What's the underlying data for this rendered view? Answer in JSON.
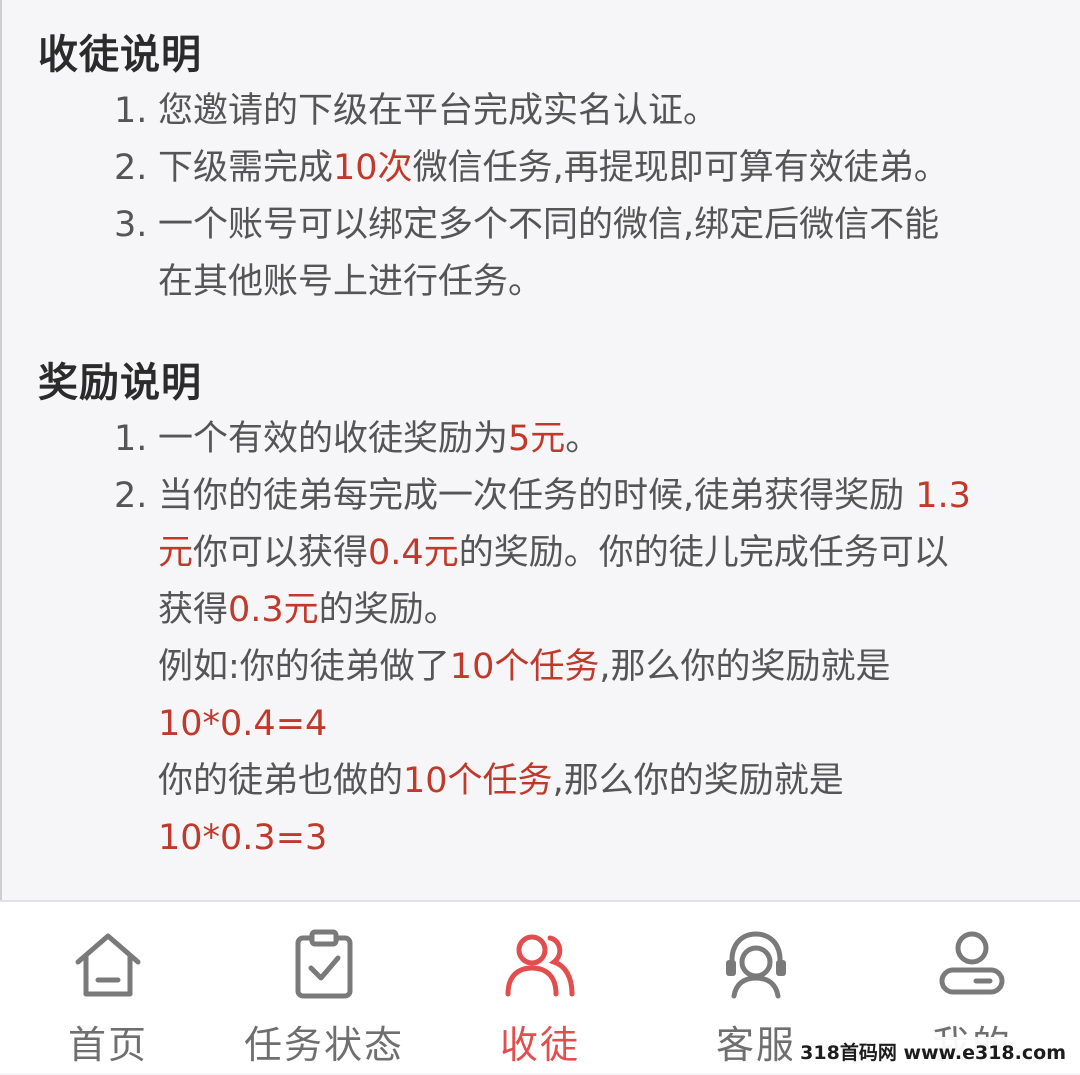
{
  "recruit_section": {
    "title": "收徒说明",
    "items": [
      {
        "num": "1.",
        "parts": [
          "您邀请的下级在平台完成实名认证。"
        ]
      },
      {
        "num": "2.",
        "parts": [
          "下级需完成",
          "10次",
          "微信任务,再提现即可算有效徒弟。"
        ]
      },
      {
        "num": "3.",
        "lines": [
          "一个账号可以绑定多个不同的微信,绑定后微信不能",
          "在其他账号上进行任务。"
        ]
      }
    ]
  },
  "reward_section": {
    "title": "奖励说明",
    "item1": {
      "num": "1.",
      "text": "一个有效的收徒奖励为",
      "amount": "5元",
      "end": "。"
    },
    "item2": {
      "num": "2.",
      "l1_text": "当你的徒弟每完成一次任务的时候,徒弟获得奖励 ",
      "l1_hl": "1.3",
      "l2_hl1": "元",
      "l2_text1": "你可以获得",
      "l2_hl2": "0.4元",
      "l2_text2": "的奖励。你的徒儿完成任务可以",
      "l3_text1": "获得",
      "l3_hl": "0.3元",
      "l3_text2": "的奖励。",
      "ex1_text1": "例如:你的徒弟做了",
      "ex1_hl": "10个任务",
      "ex1_text2": ",那么你的奖励就是",
      "ex1_formula": "10*0.4=4",
      "ex2_text1": "你的徒弟也做的",
      "ex2_hl": "10个任务",
      "ex2_text2": ",那么你的奖励就是",
      "ex2_formula": "10*0.3=3"
    }
  },
  "tabbar": {
    "tabs": [
      {
        "label": "首页",
        "icon": "home-icon",
        "active": false
      },
      {
        "label": "任务状态",
        "icon": "clipboard-check-icon",
        "active": false
      },
      {
        "label": "收徒",
        "icon": "users-icon",
        "active": true
      },
      {
        "label": "客服",
        "icon": "headset-icon",
        "active": false
      },
      {
        "label": "我的",
        "icon": "user-icon",
        "active": false
      }
    ]
  },
  "watermark": "318首码网 www.e318.com",
  "colors": {
    "accent": "#e34d4d",
    "highlight": "#c0392b",
    "text": "#555555",
    "heading": "#2b2b2b",
    "icon": "#7a7a7a"
  }
}
